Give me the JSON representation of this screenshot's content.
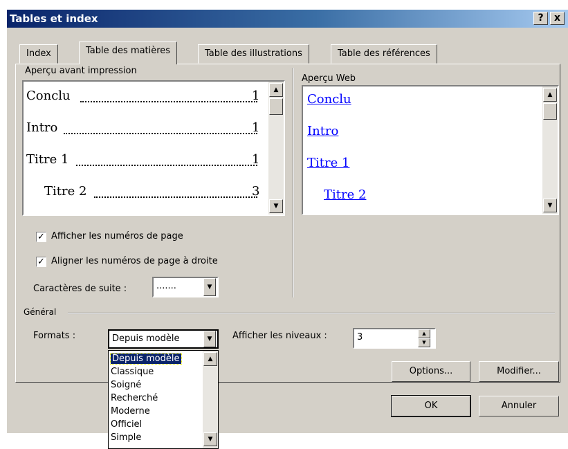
{
  "window": {
    "title": "Tables et index",
    "help_button": "?",
    "close_button": "x"
  },
  "tabs": [
    {
      "label": "Index"
    },
    {
      "label": "Table des matières"
    },
    {
      "label": "Table des illustrations"
    },
    {
      "label": "Table des références"
    }
  ],
  "print_preview": {
    "label": "Aperçu avant impression",
    "entries": [
      {
        "text": "Conclu",
        "page": "1"
      },
      {
        "text": "Intro",
        "page": "1"
      },
      {
        "text": "Titre 1",
        "page": "1"
      },
      {
        "text": "Titre 2",
        "page": "3"
      }
    ]
  },
  "web_preview": {
    "label": "Aperçu Web",
    "entries": [
      "Conclu",
      "Intro",
      "Titre 1",
      "Titre 2"
    ]
  },
  "options": {
    "show_page_numbers": {
      "label": "Afficher les numéros de page",
      "checked": true
    },
    "align_page_numbers": {
      "label": "Aligner les numéros de page à droite",
      "checked": true
    },
    "leader_label": "Caractères de suite :",
    "leader_value": "......."
  },
  "general": {
    "group_label": "Général",
    "formats_label": "Formats :",
    "formats_value": "Depuis modèle",
    "levels_label": "Afficher les niveaux :",
    "levels_value": "3",
    "formats_options": [
      "Depuis modèle",
      "Classique",
      "Soigné",
      "Recherché",
      "Moderne",
      "Officiel",
      "Simple"
    ]
  },
  "buttons": {
    "options": "Options...",
    "modify": "Modifier...",
    "ok": "OK",
    "cancel": "Annuler"
  }
}
